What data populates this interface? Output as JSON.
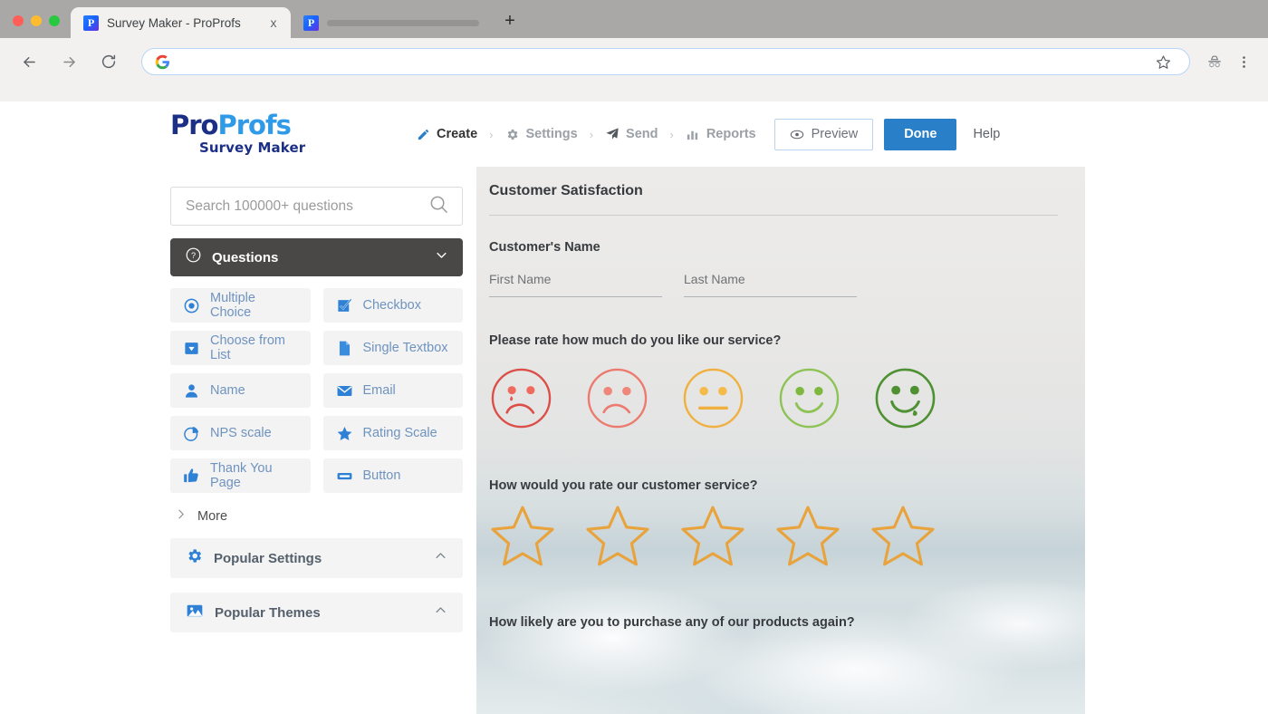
{
  "browser": {
    "tabs": [
      {
        "title": "Survey Maker - ProProfs",
        "favicon_letter": "P",
        "active": true,
        "close_label": "x"
      },
      {
        "title": "",
        "favicon_letter": "P",
        "active": false,
        "close_label": ""
      }
    ],
    "new_tab_label": "+",
    "toolbar": {
      "back_icon": "back-arrow-icon",
      "forward_icon": "forward-arrow-icon",
      "reload_icon": "reload-icon",
      "url": "",
      "url_placeholder": "",
      "site_icon": "google-g-icon",
      "bookmark_icon": "star-outline-icon",
      "incognito_icon": "incognito-icon",
      "menu_icon": "three-dot-menu-icon"
    }
  },
  "app": {
    "logo": {
      "part1": "Pro",
      "part2": "Profs",
      "subtitle": "Survey Maker"
    },
    "nav": [
      {
        "label": "Create",
        "icon": "pencil-icon",
        "active": true
      },
      {
        "label": "Settings",
        "icon": "gear-icon",
        "active": false
      },
      {
        "label": "Send",
        "icon": "paper-plane-icon",
        "active": false
      },
      {
        "label": "Reports",
        "icon": "bar-chart-icon",
        "active": false
      }
    ],
    "nav_separator": "›",
    "preview_label": "Preview",
    "done_label": "Done",
    "help_label": "Help",
    "accent_color": "#2a7fc9"
  },
  "sidebar": {
    "search_placeholder": "Search 100000+ questions",
    "search_icon": "search-icon",
    "questions_panel": {
      "label": "Questions",
      "icon": "question-mark-circle-icon",
      "chevron": "chevron-down-icon"
    },
    "question_types": [
      {
        "label": "Multiple Choice",
        "icon": "radio-button-icon"
      },
      {
        "label": "Checkbox",
        "icon": "checkbox-icon"
      },
      {
        "label": "Choose from List",
        "icon": "dropdown-icon"
      },
      {
        "label": "Single Textbox",
        "icon": "document-icon"
      },
      {
        "label": "Name",
        "icon": "person-icon"
      },
      {
        "label": "Email",
        "icon": "envelope-icon"
      },
      {
        "label": "NPS scale",
        "icon": "pie-chart-icon"
      },
      {
        "label": "Rating Scale",
        "icon": "star-filled-icon"
      },
      {
        "label": "Thank You Page",
        "icon": "thumbs-up-icon"
      },
      {
        "label": "Button",
        "icon": "button-icon"
      }
    ],
    "more_label": "More",
    "more_icon": "chevron-right-icon",
    "panels": [
      {
        "label": "Popular Settings",
        "icon": "gear-blue-icon",
        "chevron": "chevron-up-icon"
      },
      {
        "label": "Popular Themes",
        "icon": "image-icon",
        "chevron": "chevron-up-icon"
      }
    ]
  },
  "survey": {
    "title": "Customer Satisfaction",
    "name_question": {
      "label": "Customer's Name",
      "first_name_placeholder": "First Name",
      "last_name_placeholder": "Last Name"
    },
    "smiley_question": {
      "label": "Please rate how much do you like our service?",
      "options": [
        {
          "name": "crying-face",
          "color": "#e0514a",
          "mouth": "frown",
          "tear": true
        },
        {
          "name": "sad-face",
          "color": "#ec7267",
          "mouth": "frown",
          "tear": false
        },
        {
          "name": "neutral-face",
          "color": "#f0ae3c",
          "mouth": "flat",
          "tear": false
        },
        {
          "name": "smiling-face",
          "color": "#8cc152",
          "mouth": "smile",
          "tear": false
        },
        {
          "name": "very-happy-face",
          "color": "#4f9133",
          "mouth": "big-smile",
          "tear": false
        }
      ]
    },
    "stars_question": {
      "label": "How would you rate our customer service?",
      "star_count": 5,
      "star_color": "#e8a33d",
      "filled": 0
    },
    "last_question": {
      "label": "How likely are you to purchase any of our products again?"
    }
  }
}
